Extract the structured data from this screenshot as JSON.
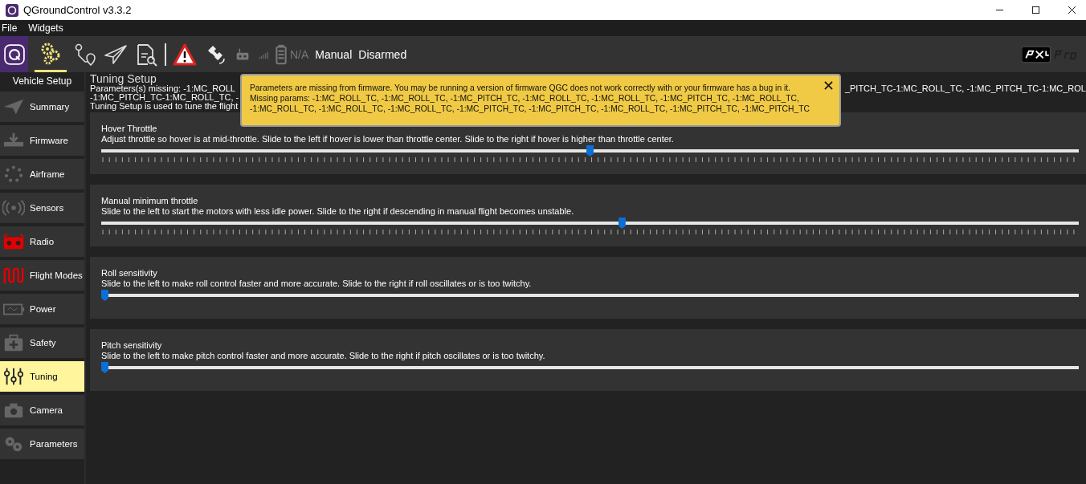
{
  "window": {
    "title": "QGroundControl v3.3.2"
  },
  "menu": [
    "File",
    "Widgets"
  ],
  "toolbar": {
    "rc_status": "N/A",
    "flight_mode": "Manual",
    "arm_state": "Disarmed"
  },
  "sidebar": {
    "title": "Vehicle Setup",
    "items": [
      {
        "label": "Summary",
        "selected": false
      },
      {
        "label": "Firmware",
        "selected": false
      },
      {
        "label": "Airframe",
        "selected": false
      },
      {
        "label": "Sensors",
        "selected": false
      },
      {
        "label": "Radio",
        "selected": false
      },
      {
        "label": "Flight Modes",
        "selected": false
      },
      {
        "label": "Power",
        "selected": false
      },
      {
        "label": "Safety",
        "selected": false
      },
      {
        "label": "Tuning",
        "selected": true
      },
      {
        "label": "Camera",
        "selected": false
      },
      {
        "label": "Parameters",
        "selected": false
      }
    ]
  },
  "header": {
    "title": "Tuning Setup",
    "missing_line_1_left": "Parameters(s) missing: -1:MC_ROLL",
    "missing_line_1_right": "_PITCH_TC-1:MC_ROLL_TC, -1:MC_PITCH_TC-1:MC_ROL",
    "missing_line_2": "-1:MC_PITCH_TC-1:MC_ROLL_TC, -",
    "description": "Tuning Setup is used to tune the flight"
  },
  "alert": {
    "text": "Parameters are missing from firmware. You may be running a version of firmware QGC does not work correctly with or your firmware has a bug in it. Missing params: -1:MC_ROLL_TC, -1:MC_ROLL_TC, -1:MC_PITCH_TC, -1:MC_ROLL_TC, -1:MC_ROLL_TC, -1:MC_PITCH_TC, -1:MC_ROLL_TC, -1:MC_ROLL_TC, -1:MC_ROLL_TC, -1:MC_ROLL_TC, -1:MC_PITCH_TC, -1:MC_PITCH_TC, -1:MC_ROLL_TC, -1:MC_PITCH_TC, -1:MC_PITCH_TC"
  },
  "sliders": [
    {
      "title": "Hover Throttle",
      "description": "Adjust throttle so hover is at mid-throttle. Slide to the left if hover is lower than throttle center. Slide to the right if hover is higher than throttle center.",
      "level": 0.5,
      "ticks": true
    },
    {
      "title": "Manual minimum throttle",
      "description": "Slide to the left to start the motors with less idle power. Slide to the right if descending in manual flight becomes unstable.",
      "level": 0.533,
      "ticks": true
    },
    {
      "title": "Roll sensitivity",
      "description": "Slide to the left to make roll control faster and more accurate. Slide to the right if roll oscillates or is too twitchy.",
      "level": 0,
      "ticks": false
    },
    {
      "title": "Pitch sensitivity",
      "description": "Slide to the left to make pitch control faster and more accurate. Slide to the right if pitch oscillates or is too twitchy.",
      "level": 0,
      "ticks": false
    }
  ]
}
